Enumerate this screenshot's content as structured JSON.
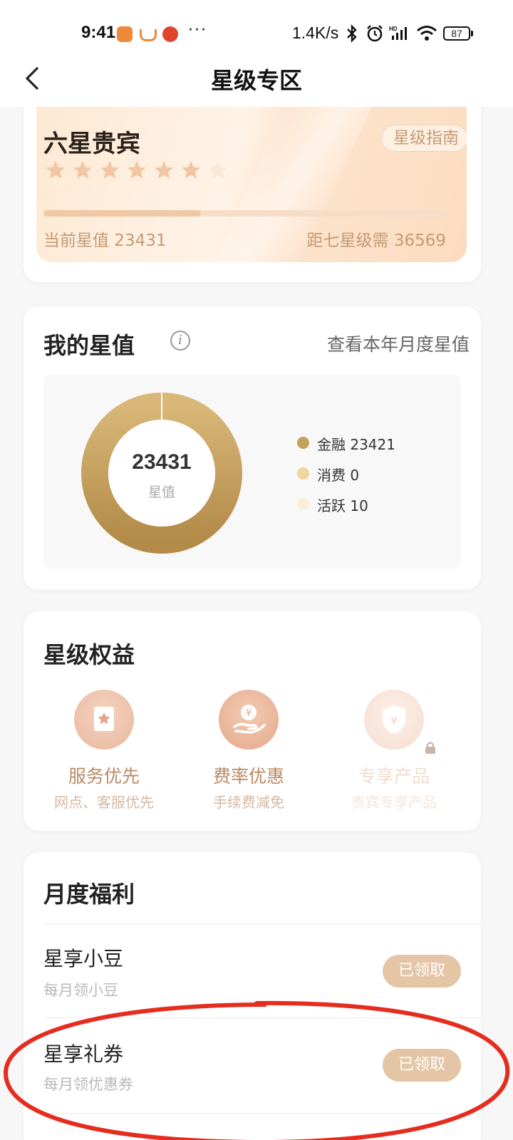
{
  "status_bar": {
    "time": "9:41",
    "more": "···",
    "net_speed": "1.4K/s",
    "battery": "87",
    "icons": [
      "app-icon-1",
      "app-icon-2",
      "app-icon-3",
      "bluetooth-icon",
      "alarm-icon",
      "signal-icon",
      "wifi-icon",
      "battery-icon"
    ]
  },
  "nav": {
    "title": "星级专区",
    "back_icon": "chevron-left-icon"
  },
  "star_card": {
    "level_name": "六星贵宾",
    "guide_label": "星级指南",
    "stars_filled": 6,
    "stars_total": 7,
    "progress_fraction": 0.39,
    "current_value_text": "当前星值 23431",
    "next_level_text": "距七星级需 36569"
  },
  "my_value": {
    "title": "我的星值",
    "view_year_label": "查看本年月度星值",
    "total": "23431",
    "total_label": "星值",
    "legend": [
      {
        "label": "金融 23421",
        "color": "#c3a05c"
      },
      {
        "label": "消费 0",
        "color": "#f0d59c"
      },
      {
        "label": "活跃 10",
        "color": "#fbeed6"
      }
    ]
  },
  "chart_data": {
    "type": "pie",
    "variant": "donut",
    "categories": [
      "金融",
      "消费",
      "活跃"
    ],
    "values": [
      23421,
      0,
      10
    ],
    "center_text": "23431",
    "center_label": "星值",
    "legend_position": "right"
  },
  "rights": {
    "title": "星级权益",
    "items": [
      {
        "name": "服务优先",
        "desc": "网点、客服优先",
        "icon": "ticket-star-icon",
        "locked": false
      },
      {
        "name": "费率优惠",
        "desc": "手续费减免",
        "icon": "hand-coin-icon",
        "locked": false
      },
      {
        "name": "专享产品",
        "desc": "贵宾专享产品",
        "icon": "shield-yen-icon",
        "locked": true
      }
    ]
  },
  "monthly": {
    "title": "月度福利",
    "items": [
      {
        "title": "星享小豆",
        "sub": "每月领小豆",
        "button": "已领取"
      },
      {
        "title": "星享礼券",
        "sub": "每月领优惠券",
        "button": "已领取"
      }
    ]
  }
}
